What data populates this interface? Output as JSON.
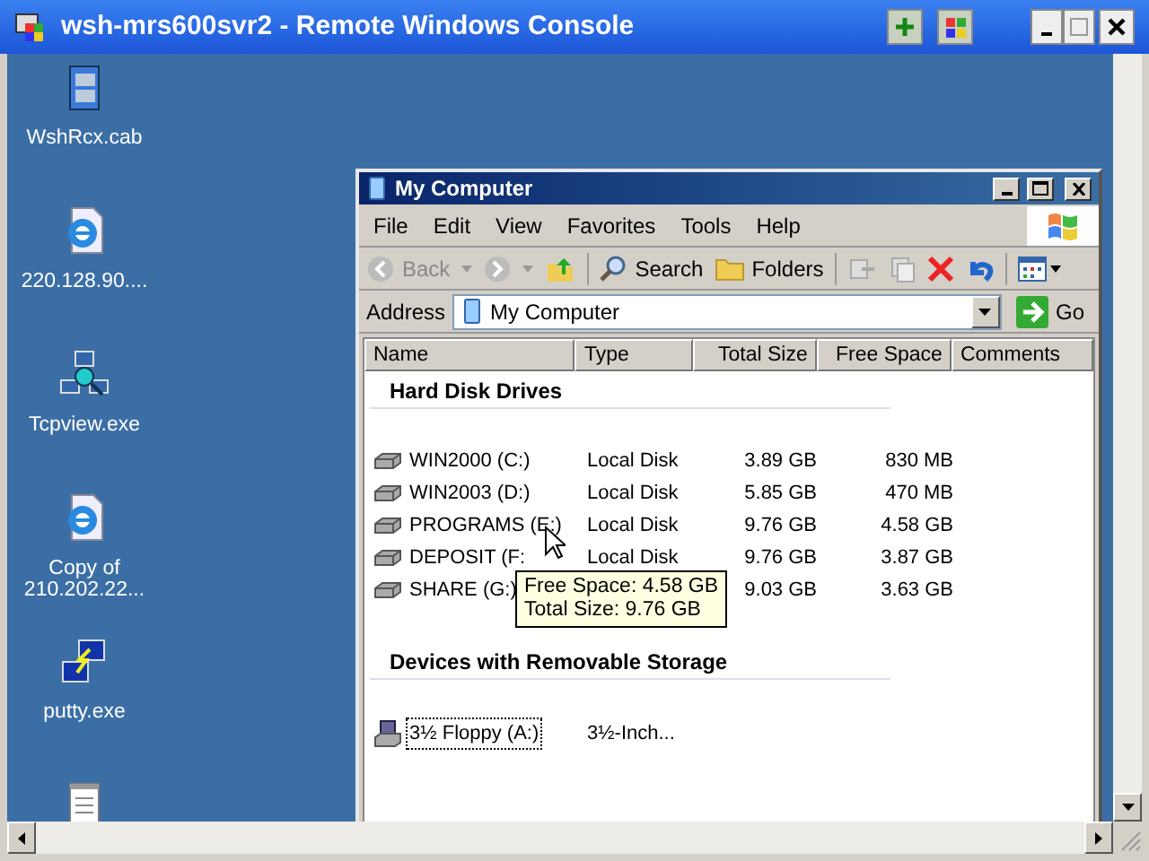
{
  "console_window": {
    "title": "wsh-mrs600svr2 - Remote Windows Console"
  },
  "desktop_icons": [
    {
      "kind": "cabinet",
      "label": "WshRcx.cab"
    },
    {
      "kind": "web",
      "label": "220.128.90...."
    },
    {
      "kind": "network",
      "label": "Tcpview.exe"
    },
    {
      "kind": "web",
      "label": "Copy of 210.202.22..."
    },
    {
      "kind": "terminal",
      "label": "putty.exe"
    },
    {
      "kind": "notepad"
    }
  ],
  "explorer": {
    "title": "My Computer",
    "menu": [
      "File",
      "Edit",
      "View",
      "Favorites",
      "Tools",
      "Help"
    ],
    "toolbar": {
      "back": "Back",
      "search": "Search",
      "folders": "Folders"
    },
    "address": {
      "label": "Address",
      "value": "My Computer",
      "go": "Go"
    },
    "columns": [
      "Name",
      "Type",
      "Total Size",
      "Free Space",
      "Comments"
    ],
    "groups": [
      {
        "title": "Hard Disk Drives",
        "items": [
          {
            "kind": "disk",
            "name": "WIN2000 (C:)",
            "type": "Local Disk",
            "total": "3.89 GB",
            "free": "830 MB",
            "focused": false
          },
          {
            "kind": "disk",
            "name": "WIN2003 (D:)",
            "type": "Local Disk",
            "total": "5.85 GB",
            "free": "470 MB",
            "focused": false
          },
          {
            "kind": "disk",
            "name": "PROGRAMS (E:)",
            "type": "Local Disk",
            "total": "9.76 GB",
            "free": "4.58 GB",
            "focused": false
          },
          {
            "kind": "disk",
            "name": "DEPOSIT (F:",
            "type": "Local Disk",
            "total": "9.76 GB",
            "free": "3.87 GB",
            "focused": false
          },
          {
            "kind": "disk",
            "name": "SHARE (G:)",
            "total": "9.03 GB",
            "free": "3.63 GB",
            "focused": false
          }
        ]
      },
      {
        "title": "Devices with Removable Storage",
        "items": [
          {
            "kind": "floppy",
            "name": "3½ Floppy (A:)",
            "type": "3½-Inch...",
            "focused": true
          }
        ]
      }
    ],
    "tooltip": [
      "Free Space: 4.58 GB",
      "Total Size: 9.76 GB"
    ]
  }
}
